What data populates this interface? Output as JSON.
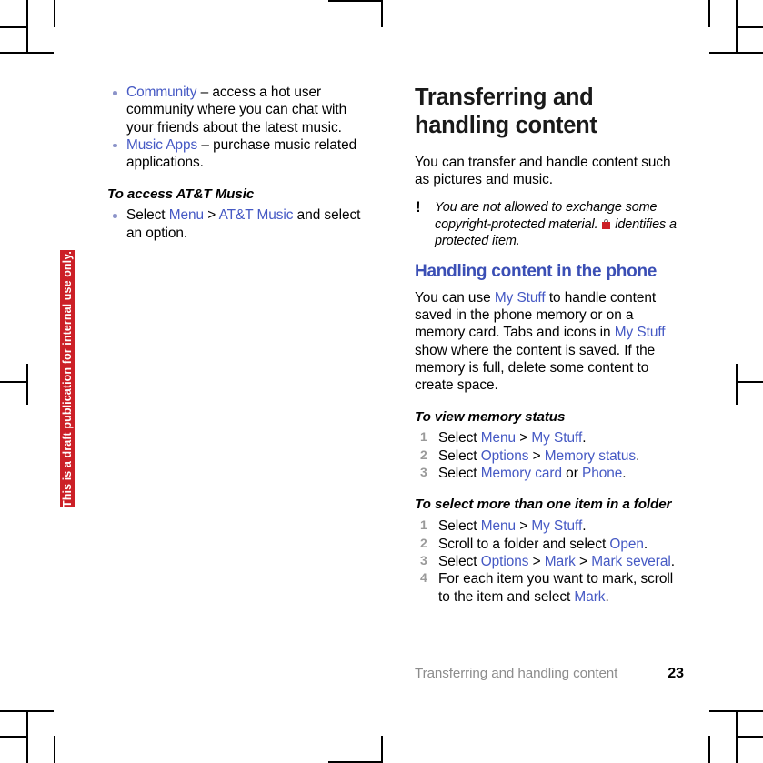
{
  "document": {
    "draft_banner": "This is a draft publication for internal use only.",
    "footer": {
      "section_title": "Transferring and handling content",
      "page_number": "23"
    },
    "colors": {
      "link_blue": "#4559c4",
      "heading_blue": "#3b4fb5",
      "draft_red": "#cc2027",
      "step_number_grey": "#9a9a9a",
      "footer_grey": "#8c8c8c"
    }
  },
  "left_column": {
    "bullets": [
      {
        "link": "Community",
        "rest": " – access a hot user community where you can chat with your friends about the latest music."
      },
      {
        "link": "Music Apps",
        "rest": " – purchase music related applications."
      }
    ],
    "task": {
      "heading": "To access AT&T Music",
      "bullet": {
        "pre": "Select ",
        "link1": "Menu",
        "sep": " > ",
        "link2": "AT&T Music",
        "post": " and select an option."
      }
    }
  },
  "right_column": {
    "chapter_title": "Transferring and handling content",
    "intro": "You can transfer and handle content such as pictures and music.",
    "note": {
      "icon": "exclamation-icon",
      "text_before_lock": "You are not allowed to exchange some copyright-protected material. ",
      "lock_icon": "padlock-icon",
      "text_after_lock": " identifies a protected item."
    },
    "section": {
      "heading": "Handling content in the phone",
      "paragraph": {
        "p1": "You can use ",
        "l1": "My Stuff",
        "p2": " to handle content saved in the phone memory or on a memory card. Tabs and icons in ",
        "l2": "My Stuff",
        "p3": " show where the content is saved. If the memory is full, delete some content to create space."
      }
    },
    "task1": {
      "heading": "To view memory status",
      "steps": [
        {
          "pre": "Select ",
          "l1": "Menu",
          "mid": " > ",
          "l2": "My Stuff",
          "post": "."
        },
        {
          "pre": "Select ",
          "l1": "Options",
          "mid": " > ",
          "l2": "Memory status",
          "post": "."
        },
        {
          "pre": "Select ",
          "l1": "Memory card",
          "mid": " or ",
          "l2": "Phone",
          "post": "."
        }
      ]
    },
    "task2": {
      "heading": "To select more than one item in a folder",
      "steps": [
        {
          "pre": "Select ",
          "l1": "Menu",
          "mid": " > ",
          "l2": "My Stuff",
          "post": "."
        },
        {
          "pre": "Scroll to a folder and select ",
          "l1": "Open",
          "mid": "",
          "l2": "",
          "post": "."
        },
        {
          "pre": "Select ",
          "l1": "Options",
          "mid": " > ",
          "l2": "Mark",
          "mid2": " > ",
          "l3": "Mark several",
          "post": "."
        },
        {
          "pre": "For each item you want to mark, scroll to the item and select ",
          "l1": "Mark",
          "mid": "",
          "l2": "",
          "post": "."
        }
      ]
    }
  }
}
